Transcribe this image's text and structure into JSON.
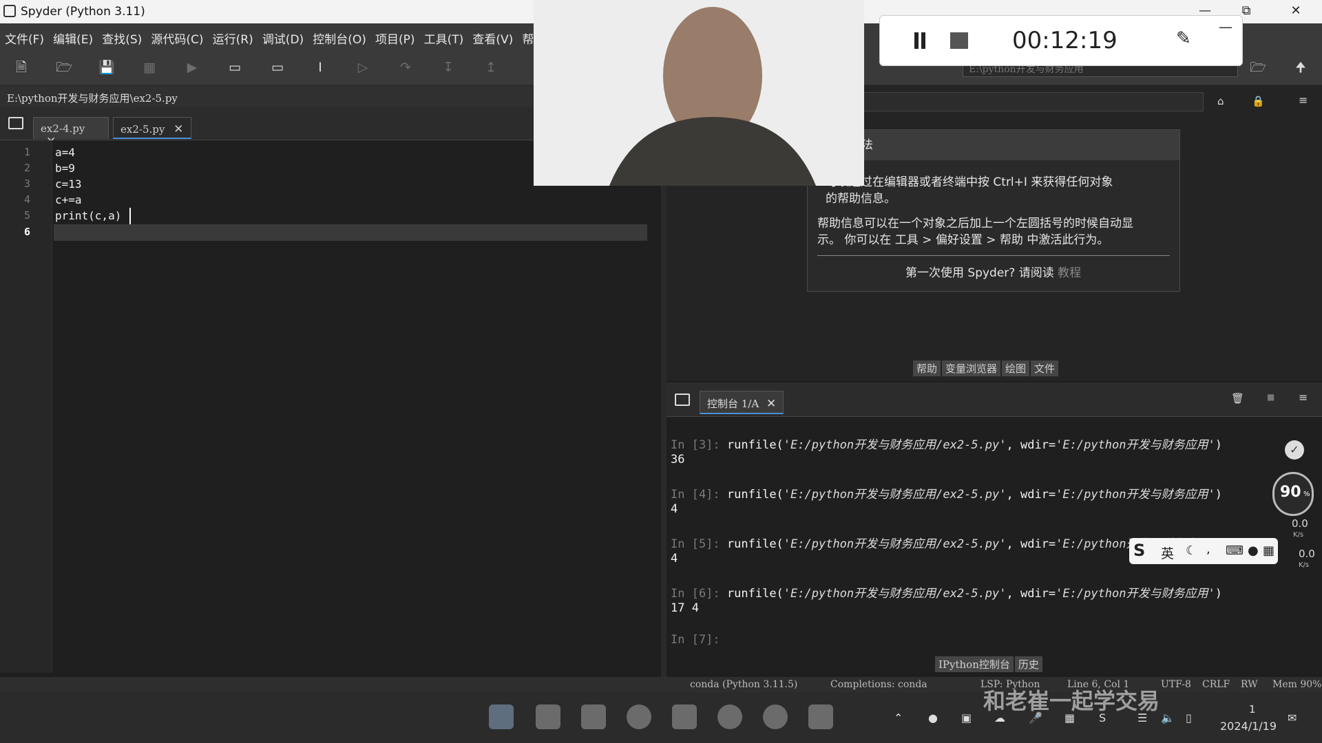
{
  "window": {
    "title": "Spyder (Python 3.11)",
    "minimize_icon": "—",
    "maximize_icon": "⧉",
    "close_icon": "✕"
  },
  "menubar": {
    "items": [
      "文件(F)",
      "编辑(E)",
      "查找(S)",
      "源代码(C)",
      "运行(R)",
      "调试(D)",
      "控制台(O)",
      "项目(P)",
      "工具(T)",
      "查看(V)",
      "帮助(H"
    ]
  },
  "toolbar": {
    "working_dir": "E:\\python开发与财务应用"
  },
  "editor": {
    "path": "E:\\python开发与财务应用\\ex2-5.py",
    "tabs": [
      {
        "label": "ex2-4.py"
      },
      {
        "label": "ex2-5.py"
      }
    ],
    "line_numbers": [
      "1",
      "2",
      "3",
      "4",
      "5",
      "6"
    ],
    "lines": [
      "a=4",
      "b=9",
      "c=13",
      "c+=a",
      "print(c,a)",
      ""
    ]
  },
  "help_panel": {
    "title_partial": "法",
    "para1_a": "可以通过在编辑器或者终端中按 Ctrl+I 来获得任何对象",
    "para1_b": "的帮助信息。",
    "para2_a": "帮助信息可以在一个对象之后加上一个左圆括号的时候自动显",
    "para2_b": "示。 你可以在 工具 > 偏好设置 > 帮助 中激活此行为。",
    "first_time": "第一次使用 Spyder? 请阅读",
    "tutorial_link": "教程",
    "tabs": [
      "帮助",
      "变量浏览器",
      "绘图",
      "文件"
    ]
  },
  "console": {
    "tab_label": "控制台 1/A",
    "entries": [
      {
        "prompt": "In [3]:",
        "code": "runfile(",
        "s1": "'E:/python开发与财务应用/ex2-5.py'",
        "mid": ", wdir=",
        "s2": "'E:/python开发与财务应用'",
        "end": ")",
        "output": "36"
      },
      {
        "prompt": "In [4]:",
        "code": "runfile(",
        "s1": "'E:/python开发与财务应用/ex2-5.py'",
        "mid": ", wdir=",
        "s2": "'E:/python开发与财务应用'",
        "end": ")",
        "output": "4"
      },
      {
        "prompt": "In [5]:",
        "code": "runfile(",
        "s1": "'E:/python开发与财务应用/ex2-5.py'",
        "mid": ", wdir=",
        "s2": "'E:/python开发与财务应用'",
        "end": ")",
        "output": "4"
      },
      {
        "prompt": "In [6]:",
        "code": "runfile(",
        "s1": "'E:/python开发与财务应用/ex2-5.py'",
        "mid": ", wdir=",
        "s2": "'E:/python开发与财务应用'",
        "end": ")",
        "output": "17 4"
      }
    ],
    "next_prompt": "In [7]:",
    "bottom_tabs": [
      "IPython控制台",
      "历史"
    ]
  },
  "statusbar": {
    "conda": "conda (Python 3.11.5)",
    "completions": "Completions: conda",
    "lsp": "LSP: Python",
    "position": "Line 6, Col 1",
    "encoding": "UTF-8",
    "eol": "CRLF",
    "rw": "RW",
    "mem": "Mem 90%"
  },
  "recorder": {
    "time": "00:12:19"
  },
  "overlay": {
    "speed_percent": "90",
    "speed_unit": "%",
    "up_rate": "0.0",
    "up_unit": "K/s",
    "down_rate": "0.0",
    "down_unit": "K/s",
    "ime_lang": "英",
    "watermark": "和老崔一起学交易"
  },
  "taskbar": {
    "date": "2024/1/19",
    "time_partial": "1"
  }
}
